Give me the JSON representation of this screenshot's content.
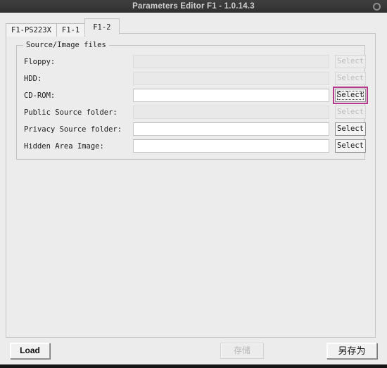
{
  "titlebar": {
    "title": "Parameters Editor F1 - 1.0.14.3",
    "button_icon": "circle-icon"
  },
  "tabs": [
    {
      "label": "F1-PS223X",
      "active": false
    },
    {
      "label": "F1-1",
      "active": false
    },
    {
      "label": "F1-2",
      "active": true
    }
  ],
  "groupbox": {
    "title": "Source/Image files",
    "rows": [
      {
        "label": "Floppy:",
        "value": "",
        "enabled": false,
        "button": "Select",
        "button_enabled": false,
        "focused": false
      },
      {
        "label": "HDD:",
        "value": "",
        "enabled": false,
        "button": "Select",
        "button_enabled": false,
        "focused": false
      },
      {
        "label": "CD-ROM:",
        "value": "",
        "enabled": true,
        "button": "Select",
        "button_enabled": true,
        "focused": true
      },
      {
        "label": "Public Source folder:",
        "value": "",
        "enabled": false,
        "button": "Select",
        "button_enabled": false,
        "focused": false
      },
      {
        "label": "Privacy Source folder:",
        "value": "",
        "enabled": true,
        "button": "Select",
        "button_enabled": true,
        "focused": false
      },
      {
        "label": "Hidden Area Image:",
        "value": "",
        "enabled": true,
        "button": "Select",
        "button_enabled": true,
        "focused": false
      }
    ]
  },
  "bottombar": {
    "load_label": "Load",
    "save_label": "存储",
    "save_as_label": "另存为"
  },
  "colors": {
    "titlebar_bg": "#383838",
    "titlebar_text": "#d2d2d2",
    "panel_bg": "#ececec",
    "focus_accent": "#b8388e",
    "field_bg": "#ffffff",
    "field_disabled_bg": "#e9e9e9"
  }
}
